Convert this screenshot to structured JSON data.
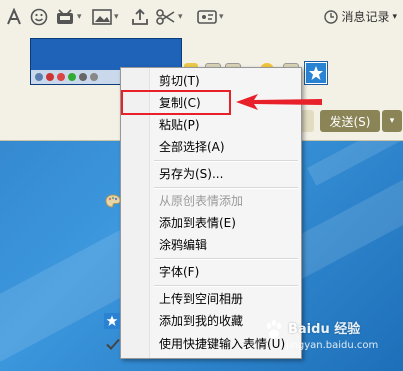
{
  "window": {
    "history_label": "消息记录",
    "history_caret": "▾",
    "send_label": "发送(S)",
    "send_caret": "▾"
  },
  "toolbar": {
    "icons": [
      "font-icon",
      "emoji-icon",
      "shake-icon",
      "image-icon",
      "upload-icon",
      "screenshot-scissors-icon",
      "more-icon",
      "clock-icon"
    ]
  },
  "context_menu": {
    "items": [
      {
        "label": "剪切(T)",
        "enabled": true
      },
      {
        "label": "复制(C)",
        "enabled": true,
        "highlighted": true
      },
      {
        "label": "粘贴(P)",
        "enabled": true
      },
      {
        "label": "全部选择(A)",
        "enabled": true
      },
      {
        "label": "另存为(S)...",
        "enabled": true
      },
      {
        "label": "从原创表情添加",
        "enabled": false
      },
      {
        "label": "添加到表情(E)",
        "enabled": true
      },
      {
        "label": "涂鸦编辑",
        "enabled": true
      },
      {
        "label": "字体(F)",
        "enabled": true
      },
      {
        "label": "上传到空间相册",
        "enabled": true
      },
      {
        "label": "添加到我的收藏",
        "enabled": true
      },
      {
        "label": "使用快捷键输入表情(U)",
        "enabled": true
      }
    ]
  },
  "annotation": {
    "color": "#e8202a"
  },
  "watermark": {
    "brand": "Baidu 经验",
    "url": "jingyan.baidu.com"
  }
}
